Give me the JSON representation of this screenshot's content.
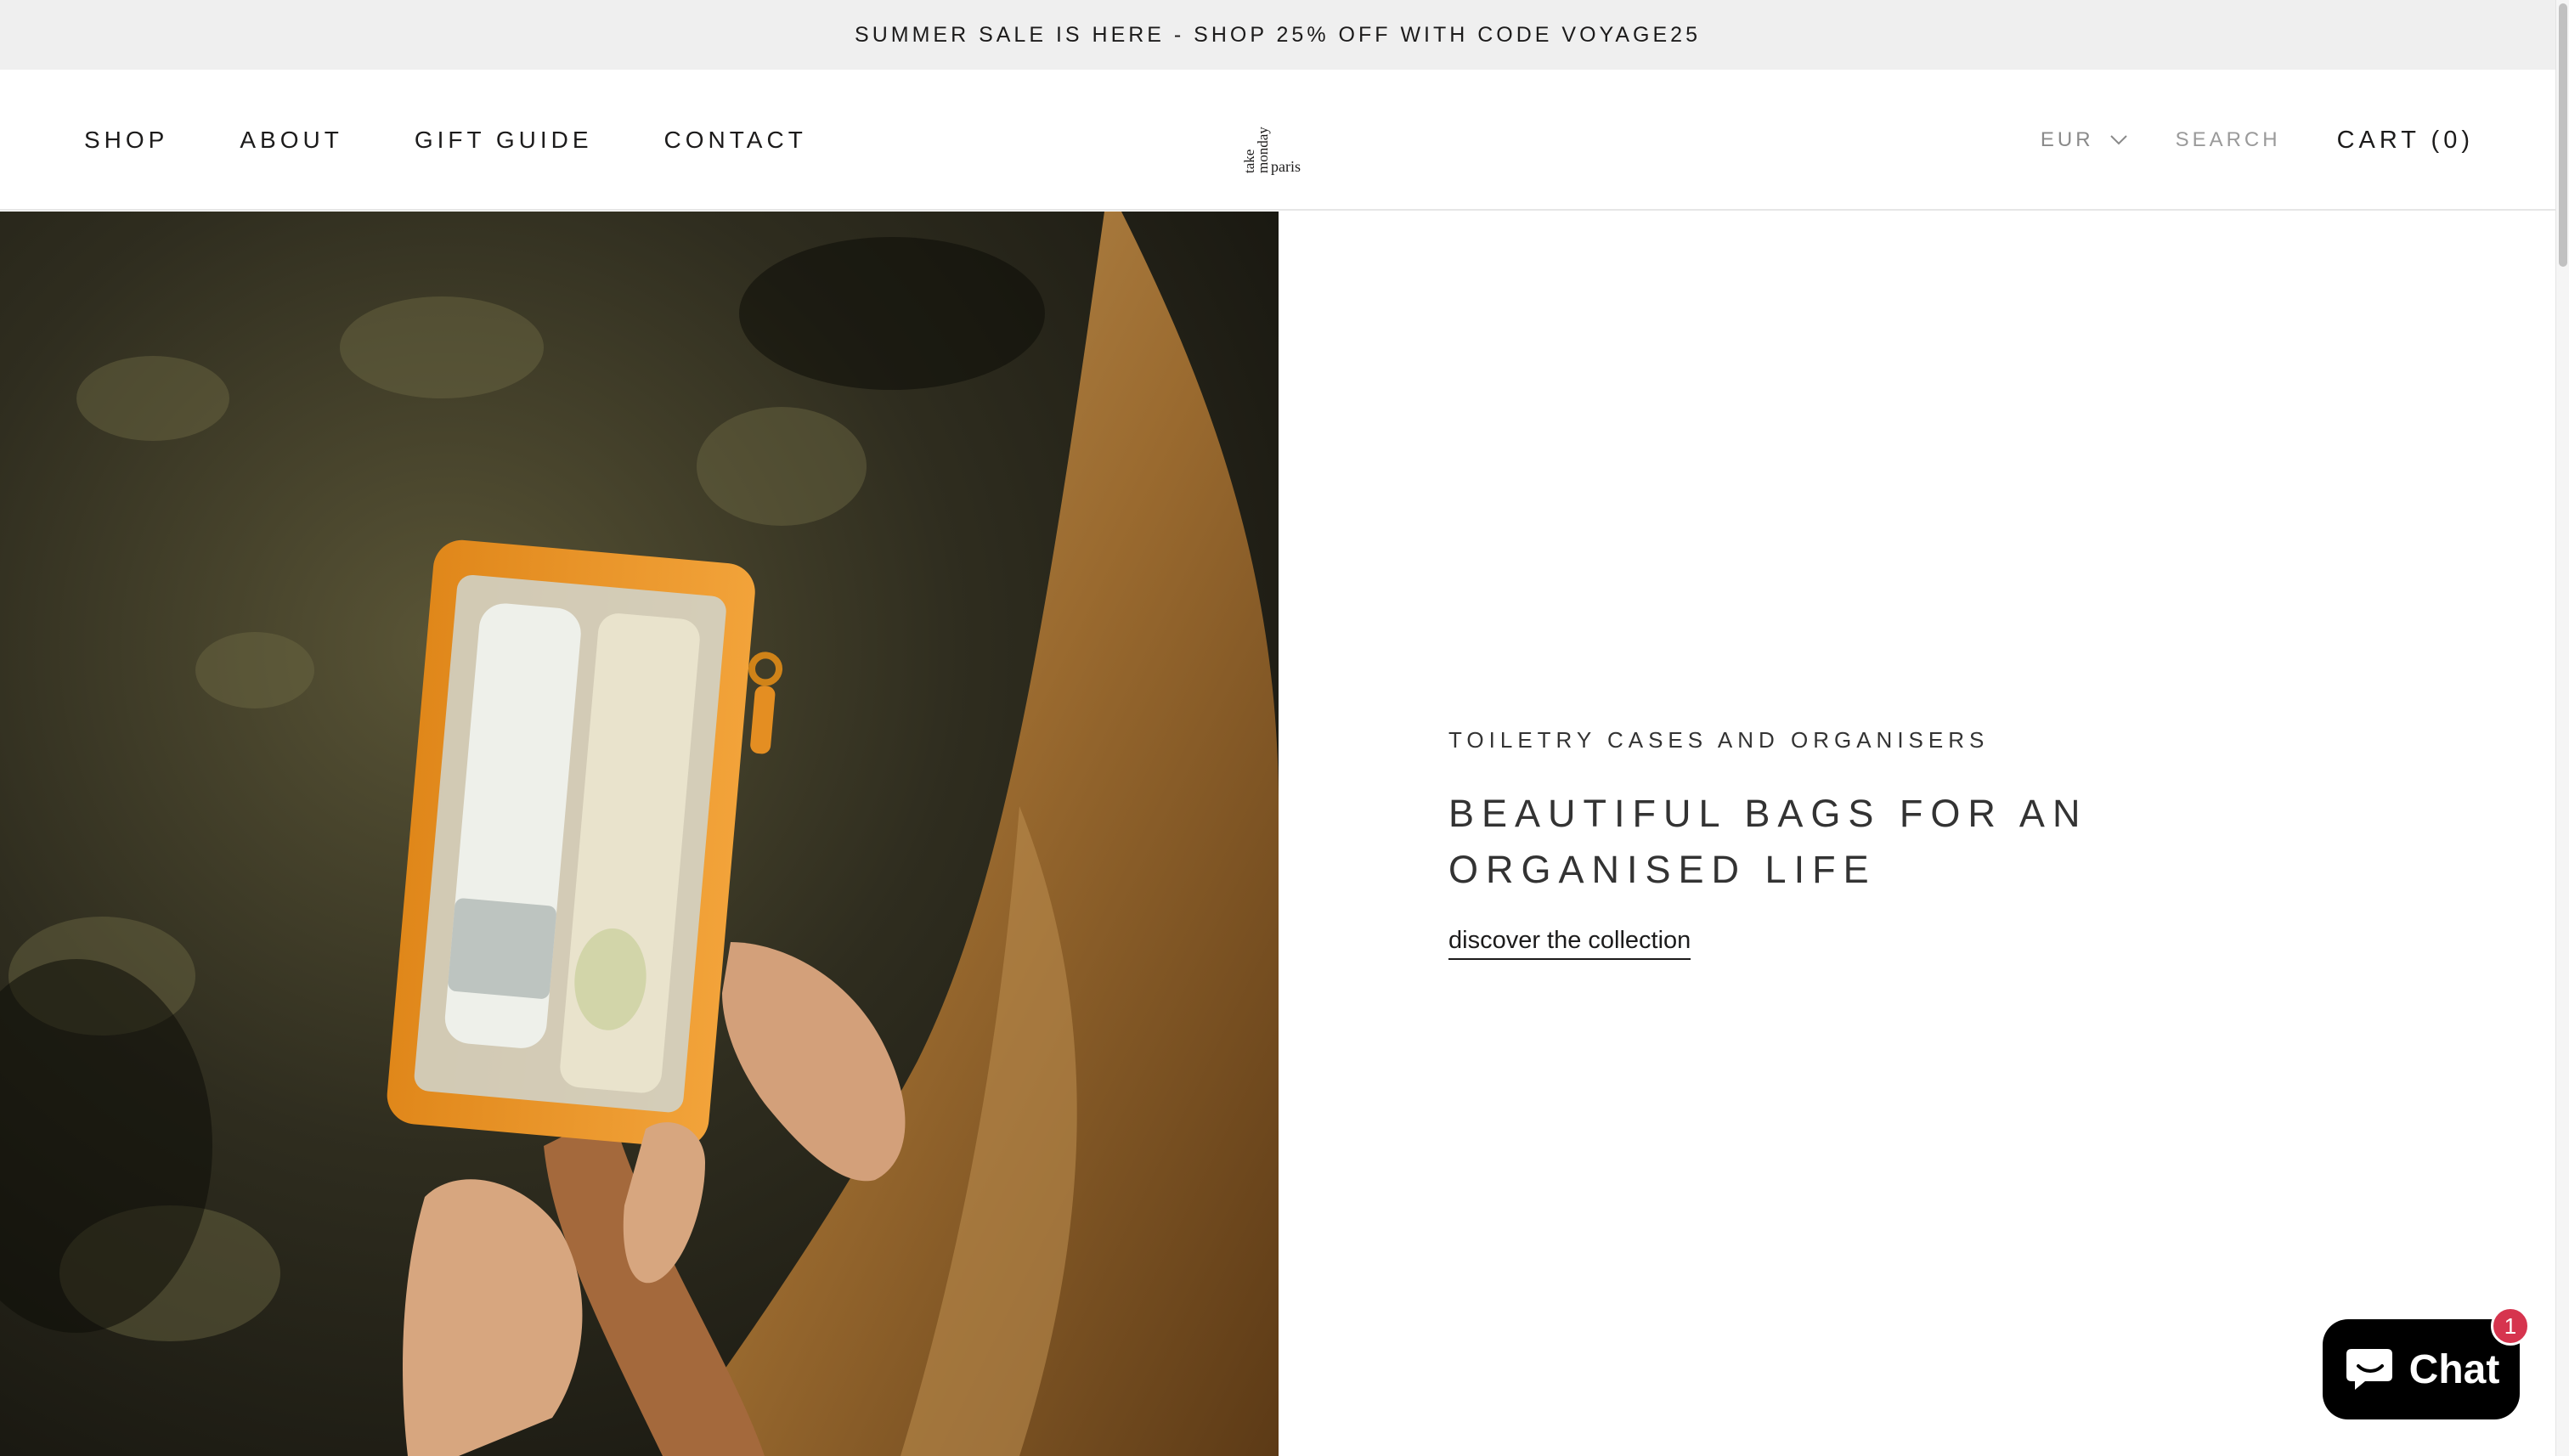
{
  "announcement": {
    "text": "SUMMER SALE IS HERE - SHOP 25% OFF WITH CODE VOYAGE25"
  },
  "nav": {
    "items": [
      {
        "label": "SHOP"
      },
      {
        "label": "ABOUT"
      },
      {
        "label": "GIFT GUIDE"
      },
      {
        "label": "CONTACT"
      }
    ]
  },
  "logo": {
    "lines": [
      "take",
      "monday",
      "paris"
    ]
  },
  "header_right": {
    "currency": "EUR",
    "search_label": "SEARCH",
    "cart_label": "CART (0)"
  },
  "hero": {
    "eyebrow": "TOILETRY CASES AND ORGANISERS",
    "heading_line1": "BEAUTIFUL BAGS FOR AN",
    "heading_line2": "ORGANISED LIFE",
    "link_label": "discover the collection"
  },
  "chat": {
    "label": "Chat",
    "badge_count": "1"
  },
  "colors": {
    "announcement_bg": "#efefef",
    "text_primary": "#1c1b1b",
    "text_muted": "#8a8a8a",
    "accent_orange": "#e8951e",
    "chat_bg": "#000000",
    "badge_red": "#d6344e"
  },
  "icons": {
    "currency_chevron": "chevron-down-icon",
    "chat": "chat-bubble-icon"
  }
}
